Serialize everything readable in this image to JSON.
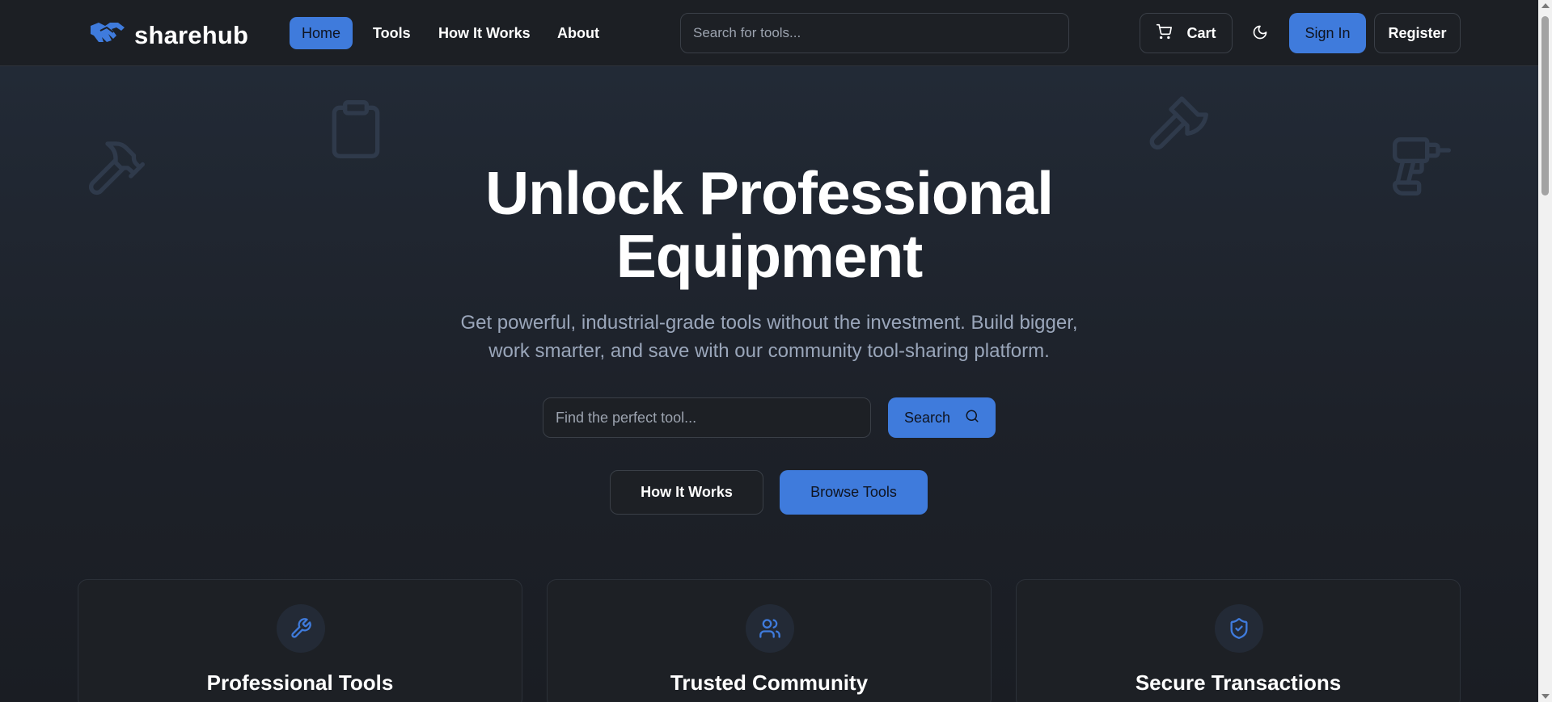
{
  "brand": {
    "name": "sharehub",
    "logo_icon": "handshake-icon",
    "accent": "#3f7bdc"
  },
  "nav": {
    "items": [
      {
        "label": "Home",
        "active": true
      },
      {
        "label": "Tools",
        "active": false
      },
      {
        "label": "How It Works",
        "active": false
      },
      {
        "label": "About",
        "active": false
      }
    ]
  },
  "header": {
    "search_placeholder": "Search for tools...",
    "cart_label": "Cart",
    "cart_icon": "cart-icon",
    "theme_icon": "moon-icon",
    "signin_label": "Sign In",
    "register_label": "Register"
  },
  "hero": {
    "title_line1": "Unlock Professional",
    "title_line2": "Equipment",
    "subtitle_line1": "Get powerful, industrial-grade tools without the investment. Build bigger,",
    "subtitle_line2": "work smarter, and save with our community tool-sharing platform.",
    "search_placeholder": "Find the perfect tool...",
    "search_button": "Search",
    "how_button": "How It Works",
    "browse_button": "Browse Tools",
    "decorations": [
      "hammer-icon",
      "clipboard-icon",
      "axe-icon",
      "drill-icon"
    ]
  },
  "features": [
    {
      "title": "Professional Tools",
      "icon": "wrench-icon"
    },
    {
      "title": "Trusted Community",
      "icon": "users-icon"
    },
    {
      "title": "Secure Transactions",
      "icon": "shield-check-icon"
    }
  ]
}
